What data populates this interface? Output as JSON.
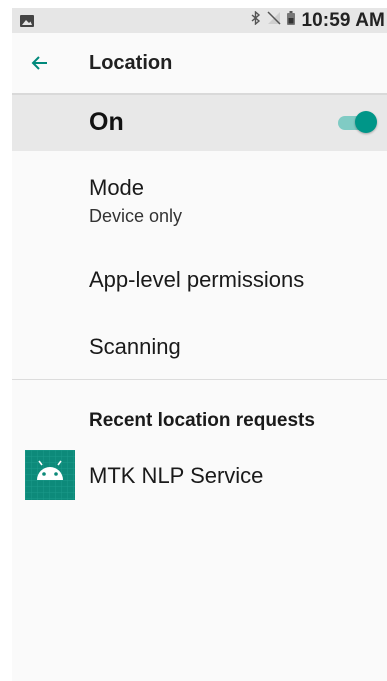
{
  "status_bar": {
    "time": "10:59 AM",
    "icons": [
      "image-icon",
      "bluetooth-icon",
      "no-sim-icon",
      "battery-icon"
    ]
  },
  "app_bar": {
    "back_icon": "arrow-back-icon",
    "title": "Location"
  },
  "master_switch": {
    "label": "On",
    "state": true,
    "accent_color": "#009688"
  },
  "settings": {
    "mode": {
      "title": "Mode",
      "value": "Device only"
    },
    "app_permissions": {
      "title": "App-level permissions"
    },
    "scanning": {
      "title": "Scanning"
    }
  },
  "recent_requests": {
    "header": "Recent location requests",
    "items": [
      {
        "name": "MTK NLP Service",
        "icon": "android-app-icon"
      }
    ]
  }
}
